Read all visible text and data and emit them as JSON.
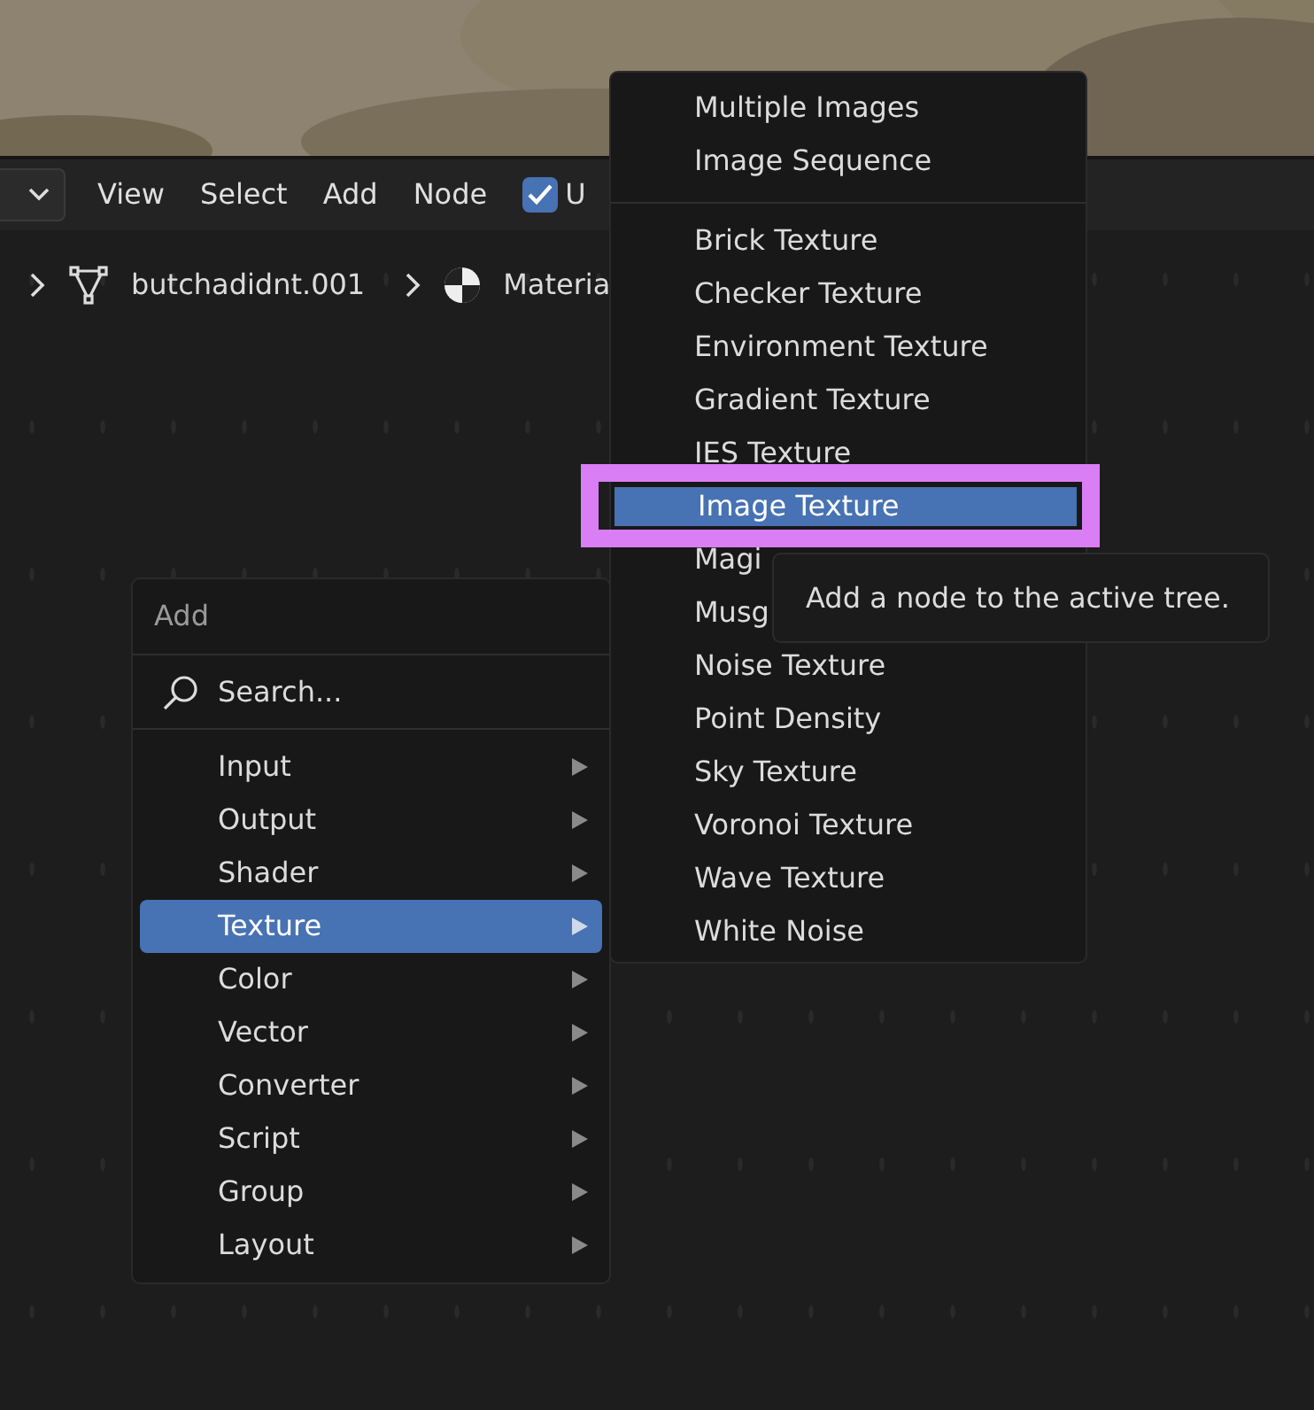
{
  "header": {
    "menus": [
      "View",
      "Select",
      "Add",
      "Node"
    ],
    "toggle": {
      "label": "U",
      "checked": true
    }
  },
  "breadcrumb": [
    {
      "kind": "mesh",
      "label": "butchadidnt.001"
    },
    {
      "kind": "material",
      "label": "Materia"
    }
  ],
  "add_menu": {
    "title": "Add",
    "search": {
      "placeholder": "Search..."
    },
    "items": [
      {
        "label": "Input",
        "selected": false
      },
      {
        "label": "Output",
        "selected": false
      },
      {
        "label": "Shader",
        "selected": false
      },
      {
        "label": "Texture",
        "selected": true
      },
      {
        "label": "Color",
        "selected": false
      },
      {
        "label": "Vector",
        "selected": false
      },
      {
        "label": "Converter",
        "selected": false
      },
      {
        "label": "Script",
        "selected": false
      },
      {
        "label": "Group",
        "selected": false
      },
      {
        "label": "Layout",
        "selected": false
      }
    ]
  },
  "texture_menu": {
    "groups": [
      [
        {
          "label": "Multiple Images",
          "selected": false
        },
        {
          "label": "Image Sequence",
          "selected": false
        }
      ],
      [
        {
          "label": "Brick Texture",
          "selected": false
        },
        {
          "label": "Checker Texture",
          "selected": false
        },
        {
          "label": "Environment Texture",
          "selected": false
        },
        {
          "label": "Gradient Texture",
          "selected": false
        },
        {
          "label": "IES Texture",
          "selected": false
        },
        {
          "label": "Image Texture",
          "selected": true
        },
        {
          "label": "Magi",
          "selected": false
        },
        {
          "label": "Musg",
          "selected": false
        },
        {
          "label": "Noise Texture",
          "selected": false
        },
        {
          "label": "Point Density",
          "selected": false
        },
        {
          "label": "Sky Texture",
          "selected": false
        },
        {
          "label": "Voronoi Texture",
          "selected": false
        },
        {
          "label": "Wave Texture",
          "selected": false
        },
        {
          "label": "White Noise",
          "selected": false
        }
      ]
    ]
  },
  "tooltip": "Add a node to the active tree."
}
